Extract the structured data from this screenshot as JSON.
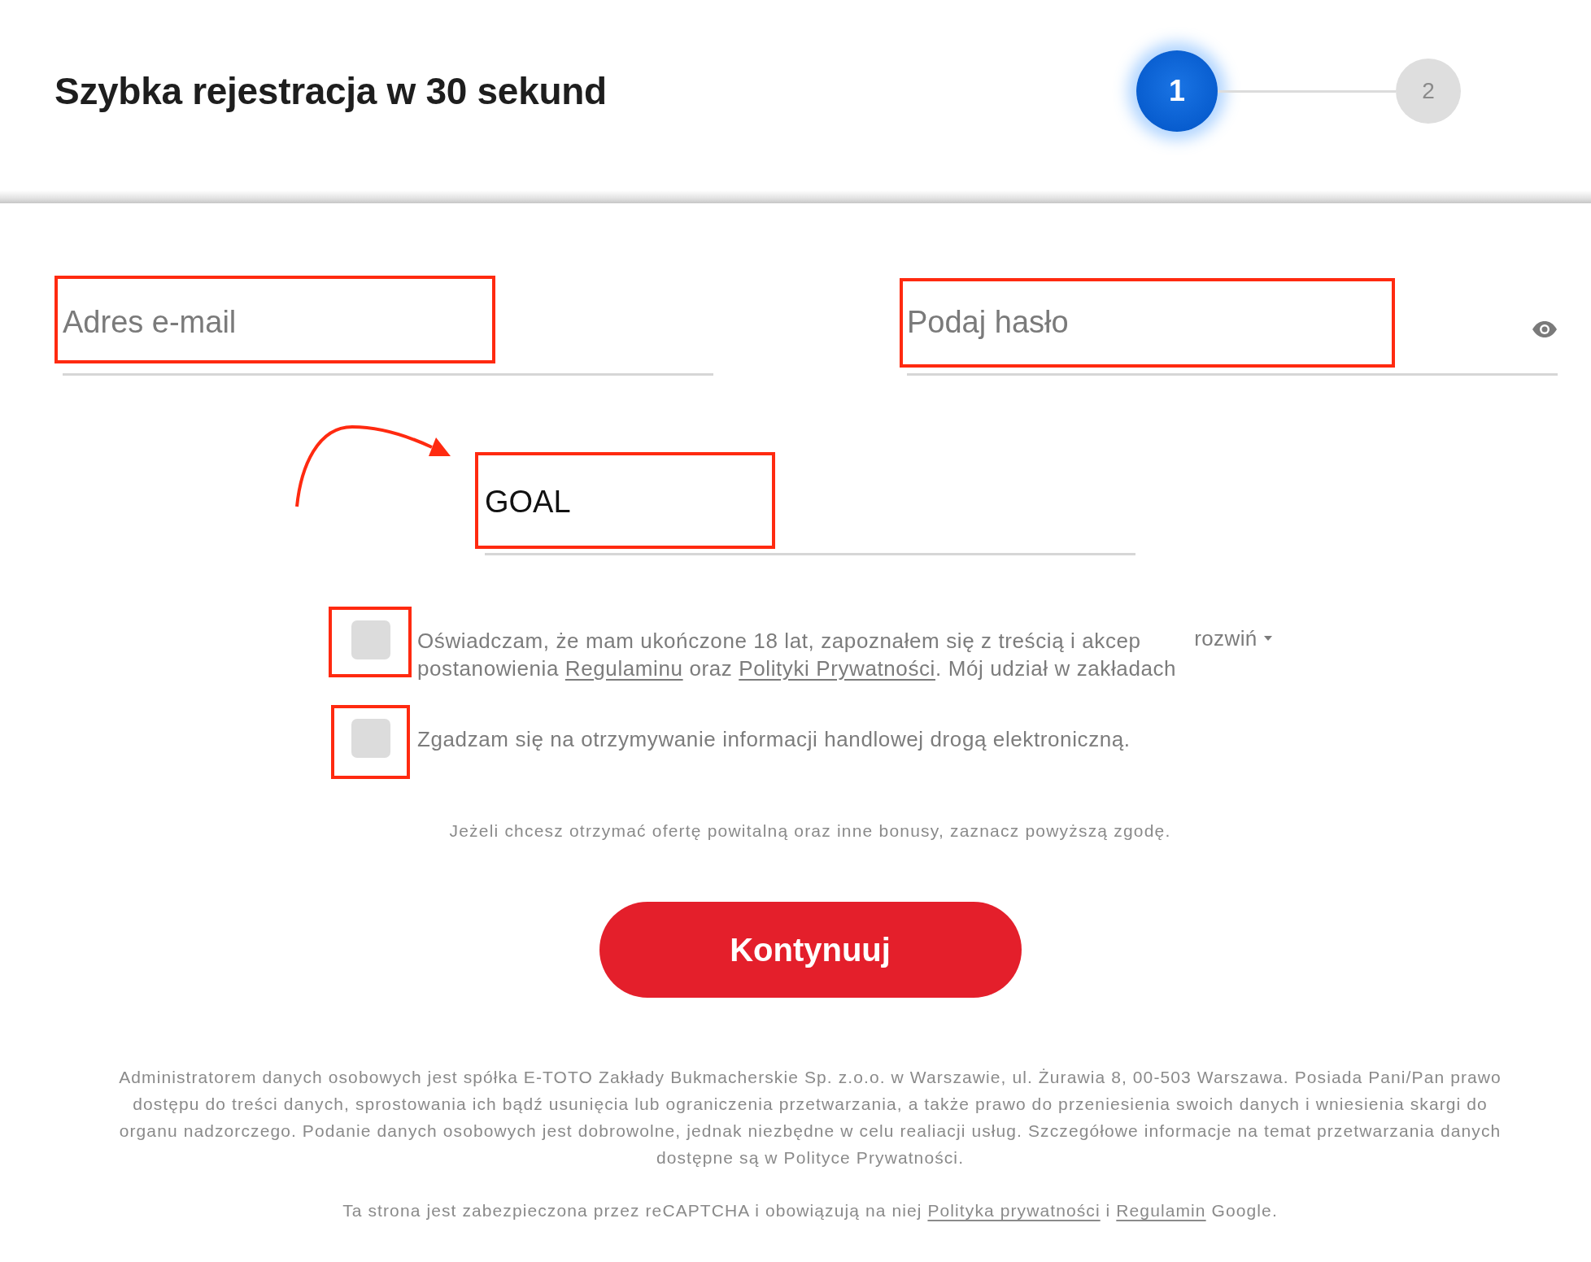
{
  "header": {
    "title": "Szybka rejestracja w 30 sekund",
    "steps": [
      {
        "label": "1",
        "selected": true
      },
      {
        "label": "2",
        "selected": false
      }
    ]
  },
  "fields": [
    {
      "kind": "email",
      "placeholder": "Adres e-mail",
      "highlighted": true
    },
    {
      "kind": "password",
      "placeholder": "Podaj hasło",
      "highlighted": true
    }
  ],
  "promo_field": {
    "value": "GOAL",
    "highlighted": true,
    "pointer_arrow": true
  },
  "consents": [
    {
      "checked": false,
      "highlighted": true,
      "lines": [
        [
          {
            "kind": "text",
            "text": "Oświadczam, że mam ukończone 18 lat, zapoznałem się z treścią i akcep"
          }
        ],
        [
          {
            "kind": "text",
            "text": "postanowienia "
          },
          {
            "kind": "link",
            "text": "Regulaminu"
          },
          {
            "kind": "text",
            "text": " oraz "
          },
          {
            "kind": "link",
            "text": "Polityki Prywatności"
          },
          {
            "kind": "text",
            "text": ". Mój udział w zakładach"
          }
        ]
      ],
      "expand_label": "rozwiń"
    },
    {
      "checked": false,
      "highlighted": true,
      "lines": [
        [
          {
            "kind": "text",
            "text": "Zgadzam się na otrzymywanie informacji handlowej drogą elektroniczną."
          }
        ]
      ]
    }
  ],
  "hint": "Jeżeli chcesz otrzymać ofertę powitalną oraz inne bonusy, zaznacz powyższą zgodę.",
  "continue_button": {
    "label": "Kontynuuj"
  },
  "footer": {
    "notice_lines": [
      "Administratorem danych osobowych jest spółka E-TOTO Zakłady Bukmacherskie Sp. z.o.o. w Warszawie, ul. Żurawia 8, 00-503 Warszawa. Posiada Pani/Pan prawo",
      "dostępu do treści danych, sprostowania ich bądź usunięcia lub ograniczenia przetwarzania, a także prawo do przeniesienia swoich danych i wniesienia skargi do",
      "organu nadzorczego. Podanie danych osobowych jest dobrowolne, jednak niezbędne w celu realiacji usług. Szczegółowe informacje na temat przetwarzania danych",
      "dostępne są w Polityce Prywatności."
    ],
    "recaptcha": [
      {
        "kind": "text",
        "text": "Ta strona jest zabezpieczona przez reCAPTCHA i obowiązują na niej "
      },
      {
        "kind": "link",
        "text": "Polityka prywatności"
      },
      {
        "kind": "text",
        "text": " i "
      },
      {
        "kind": "link",
        "text": "Regulamin"
      },
      {
        "kind": "text",
        "text": " Google."
      }
    ]
  }
}
